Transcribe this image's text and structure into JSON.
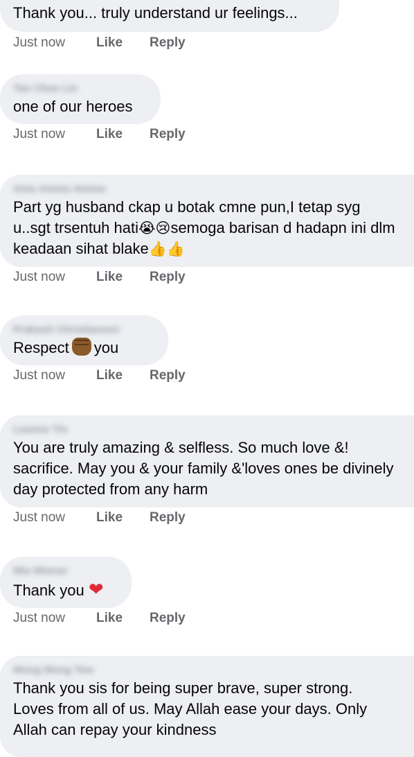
{
  "comments": [
    {
      "author": "",
      "text": "Thank you... truly understand ur feelings...",
      "time": "Just now",
      "like": "Like",
      "reply": "Reply"
    },
    {
      "author": "Tan Chee Lin",
      "text": "one of our heroes",
      "time": "Just now",
      "like": "Like",
      "reply": "Reply"
    },
    {
      "author": "Amu Ammu Ammu",
      "text": "Part yg husband ckap u botak cmne pun,I tetap syg u..sgt trsentuh hati",
      "text_after_emoji": "semoga barisan d hadapn ini dlm keadaan sihat blake",
      "emoji_mid": "😭😢",
      "emoji_end": "👍👍",
      "time": "Just now",
      "like": "Like",
      "reply": "Reply"
    },
    {
      "author": "Prakash Christiansen",
      "text_before": "Respect",
      "text_after": "you",
      "time": "Just now",
      "like": "Like",
      "reply": "Reply"
    },
    {
      "author": "Leanne Tin",
      "text": "You are truly amazing & selfless. So much love &! sacrifice. May you & your family &'loves ones be divinely day protected from any harm",
      "time": "Just now",
      "like": "Like",
      "reply": "Reply"
    },
    {
      "author": "Mia Wiener",
      "text": "Thank you",
      "time": "Just now",
      "like": "Like",
      "reply": "Reply"
    },
    {
      "author": "Mong Mong Tew",
      "text": "Thank you sis for being super brave, super strong. Loves from all of us. May Allah ease your days. Only Allah can repay your kindness"
    }
  ],
  "icons": {
    "heart": "❤",
    "fist": "raised-fist-icon"
  },
  "colors": {
    "bubble": "#eeeff2",
    "action_text": "#65676b",
    "heart": "#e02a36"
  }
}
